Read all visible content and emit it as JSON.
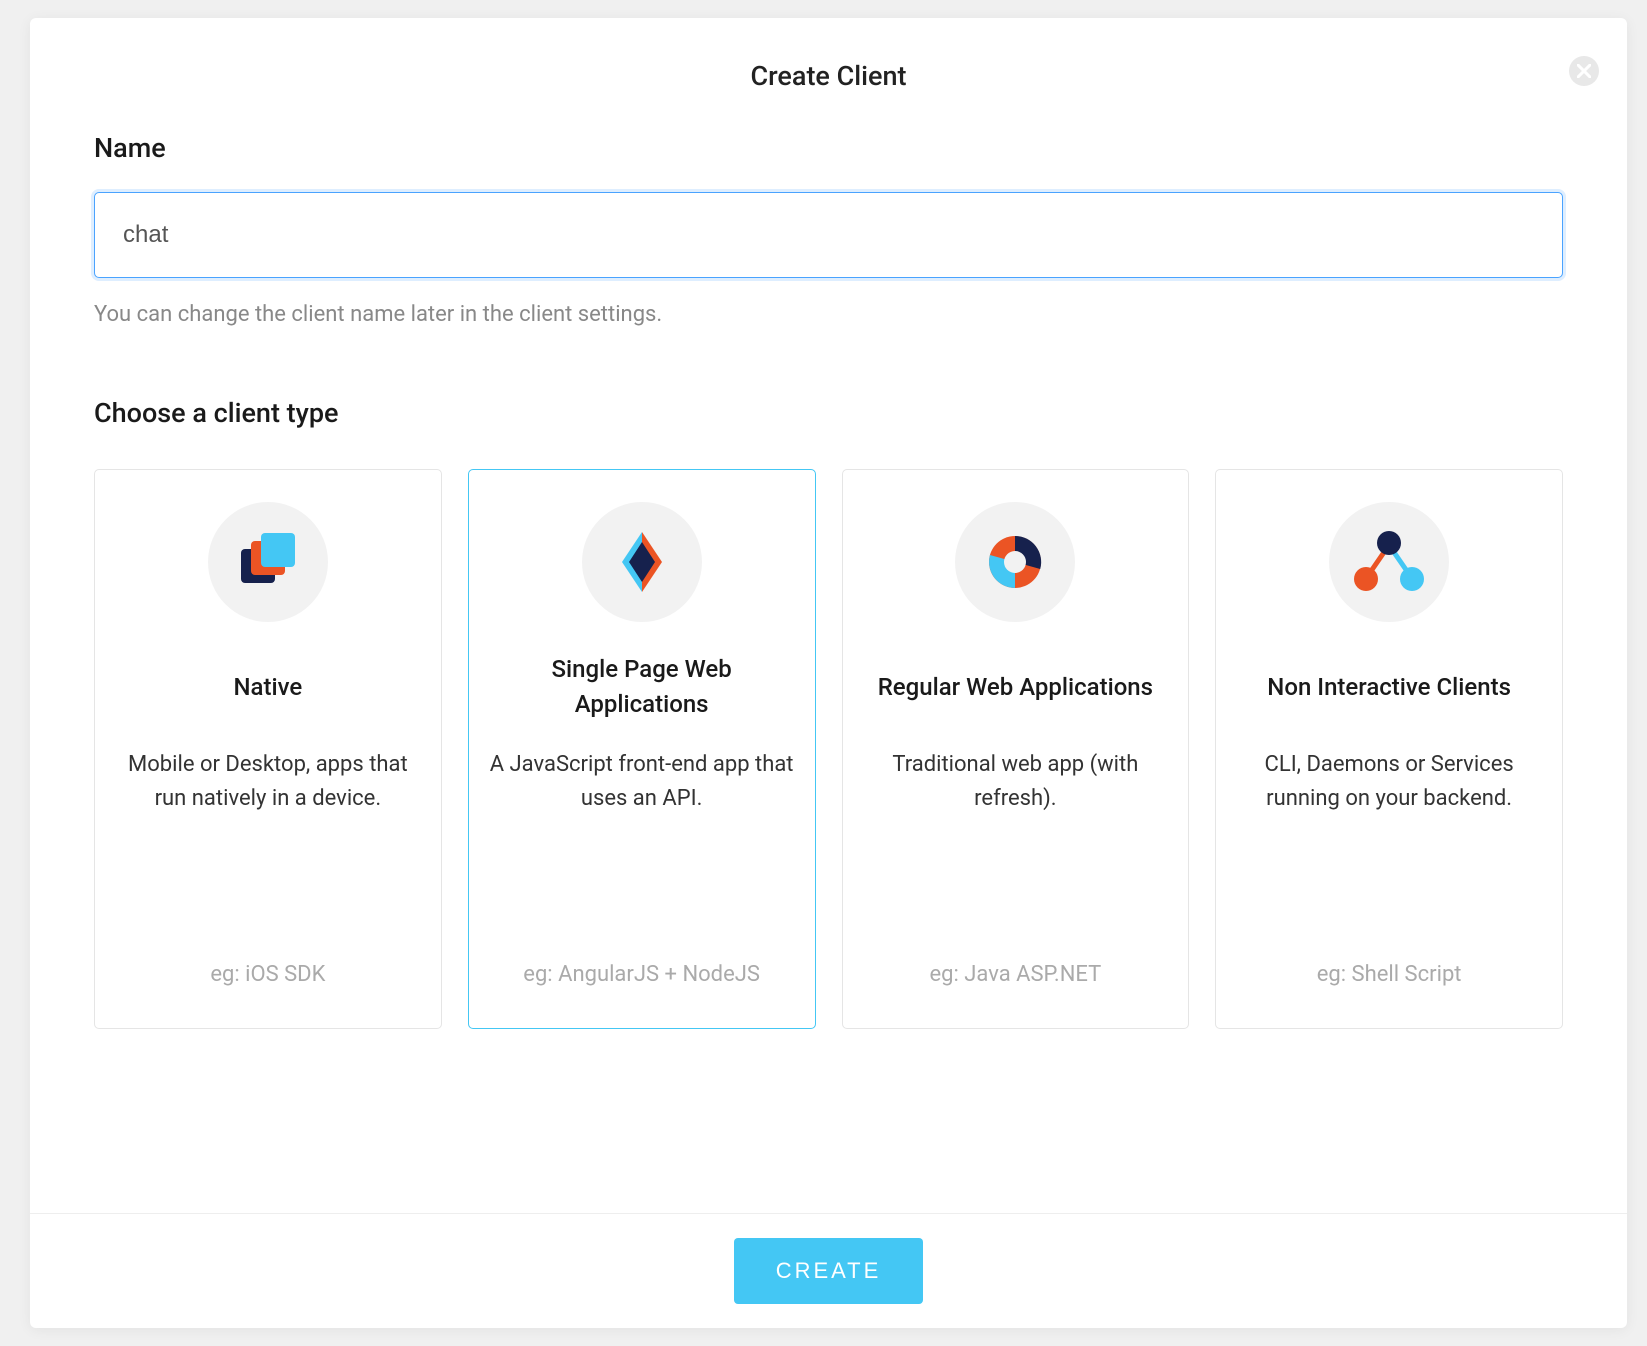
{
  "modal": {
    "title": "Create Client",
    "name_label": "Name",
    "name_value": "chat",
    "name_hint": "You can change the client name later in the client settings.",
    "type_label": "Choose a client type",
    "create_label": "CREATE"
  },
  "client_types": [
    {
      "id": "native",
      "title": "Native",
      "description": "Mobile or Desktop, apps that run natively in a device.",
      "example": "eg: iOS SDK",
      "selected": false,
      "icon": "stacked-squares-icon"
    },
    {
      "id": "spa",
      "title": "Single Page Web Applications",
      "description": "A JavaScript front-end app that uses an API.",
      "example": "eg: AngularJS + NodeJS",
      "selected": true,
      "icon": "diamond-icon"
    },
    {
      "id": "regular-web",
      "title": "Regular Web Applications",
      "description": "Traditional web app (with refresh).",
      "example": "eg: Java ASP.NET",
      "selected": false,
      "icon": "donut-icon"
    },
    {
      "id": "non-interactive",
      "title": "Non Interactive Clients",
      "description": "CLI, Daemons or Services running on your backend.",
      "example": "eg: Shell Script",
      "selected": false,
      "icon": "nodes-icon"
    }
  ],
  "colors": {
    "accent": "#44c7f4",
    "orange": "#eb5424",
    "navy": "#16214d",
    "blue": "#44c7f4"
  }
}
